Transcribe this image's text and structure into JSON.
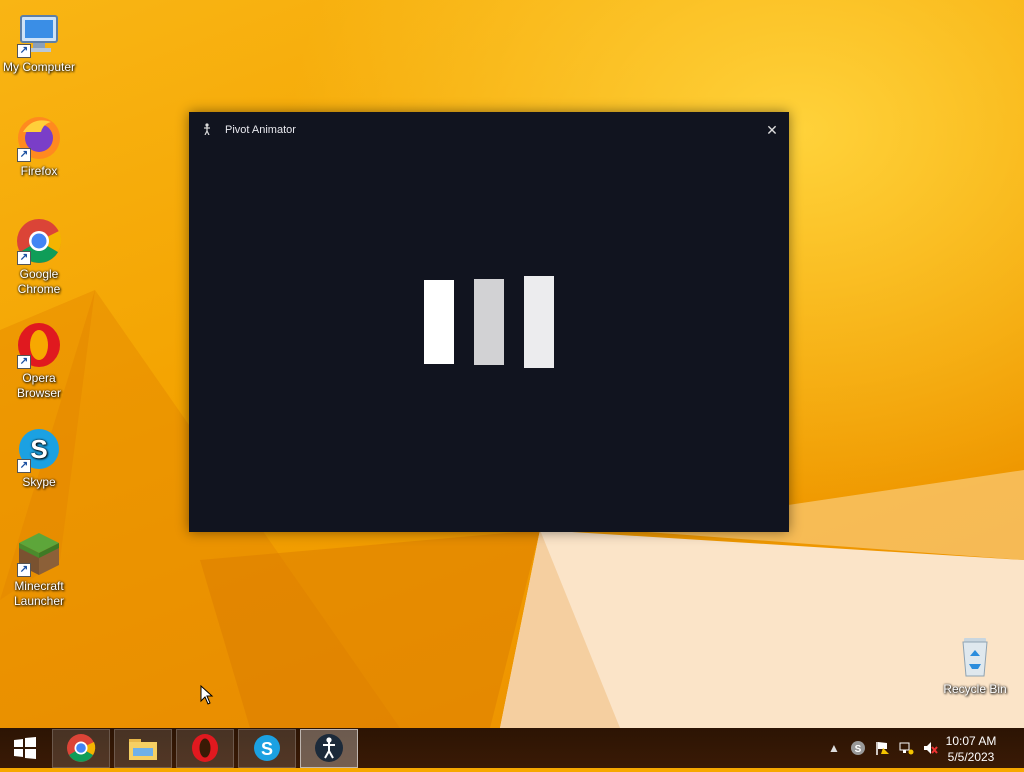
{
  "desktop": {
    "icons": [
      {
        "label": "My Computer",
        "icon": "computer-icon"
      },
      {
        "label": "Firefox",
        "icon": "firefox-icon"
      },
      {
        "label": "Google Chrome",
        "icon": "chrome-icon"
      },
      {
        "label": "Opera Browser",
        "icon": "opera-icon"
      },
      {
        "label": "Skype",
        "icon": "skype-icon"
      },
      {
        "label": "Minecraft Launcher",
        "icon": "minecraft-icon"
      }
    ],
    "recycle_bin": {
      "label": "Recycle Bin",
      "icon": "recycle-bin-icon"
    }
  },
  "window": {
    "title": "Pivot Animator",
    "close_label": "✕",
    "loading_bar_colors": [
      "#ffffff",
      "#d2d2d4",
      "#ececee"
    ]
  },
  "taskbar": {
    "apps": [
      {
        "name": "chrome",
        "icon": "chrome-icon"
      },
      {
        "name": "file-explorer",
        "icon": "folder-icon"
      },
      {
        "name": "opera",
        "icon": "opera-icon"
      },
      {
        "name": "skype",
        "icon": "skype-icon"
      },
      {
        "name": "pivot-animator",
        "icon": "pivot-icon",
        "active": true
      }
    ],
    "tray": {
      "time": "10:07 AM",
      "date": "5/5/2023"
    }
  },
  "colors": {
    "accent": "#f7a800",
    "window_bg": "#11141f",
    "taskbar_bg": "#2c1404"
  }
}
